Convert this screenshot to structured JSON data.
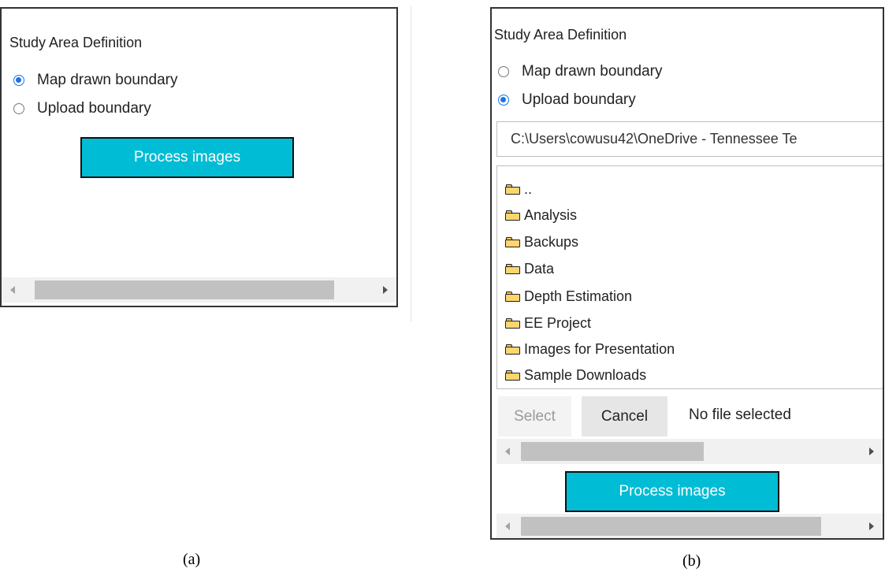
{
  "panel_a": {
    "title": "Study Area Definition",
    "radios": [
      {
        "label": "Map drawn boundary",
        "checked": true
      },
      {
        "label": "Upload boundary",
        "checked": false
      }
    ],
    "process_button": "Process images",
    "caption": "(a)"
  },
  "panel_b": {
    "title": "Study Area Definition",
    "radios": [
      {
        "label": "Map drawn boundary",
        "checked": false
      },
      {
        "label": "Upload boundary",
        "checked": true
      }
    ],
    "path": "C:\\Users\\cowusu42\\OneDrive - Tennessee Te",
    "folders": [
      "..",
      "Analysis",
      "Backups",
      "Data",
      "Depth Estimation",
      "EE Project",
      "Images for Presentation",
      "Sample Downloads"
    ],
    "select_button": "Select",
    "cancel_button": "Cancel",
    "status": "No file selected",
    "process_button": "Process images",
    "caption": "(b)"
  },
  "colors": {
    "accent": "#00bcd4",
    "radio_checked": "#1a73e8",
    "folder_fill": "#fcd56f"
  },
  "icons": {
    "folder": "folder-icon",
    "scroll_left": "arrow-left-icon",
    "scroll_right": "arrow-right-icon"
  }
}
